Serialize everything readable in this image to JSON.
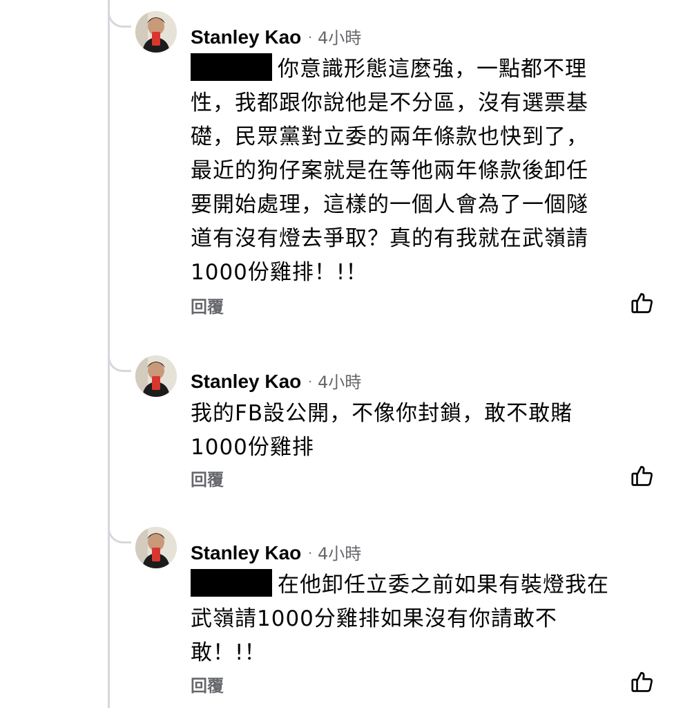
{
  "comments": [
    {
      "author": "Stanley Kao",
      "separator": "·",
      "time": "4小時",
      "lines": [
        "你意識形態這麼強，一點都不理",
        "性，我都跟你說他是不分區，沒有選票基",
        "礎，民眾黨對立委的兩年條款也快到了，",
        "最近的狗仔案就是在等他兩年條款後卸任",
        "要開始處理，這樣的一個人會為了一個隧",
        "道有沒有燈去爭取？真的有我就在武嶺請",
        "1000份雞排！!！"
      ],
      "reply_label": "回覆",
      "like_icon": "thumbs-up-icon"
    },
    {
      "author": "Stanley Kao",
      "separator": "·",
      "time": "4小時",
      "lines": [
        "我的FB設公開，不像你封鎖，敢不敢賭",
        "1000份雞排"
      ],
      "reply_label": "回覆",
      "like_icon": "thumbs-up-icon"
    },
    {
      "author": "Stanley Kao",
      "separator": "·",
      "time": "4小時",
      "lines": [
        "在他卸任立委之前如果有裝燈我在",
        "武嶺請1000分雞排如果沒有你請敢不",
        "敢！!！"
      ],
      "reply_label": "回覆",
      "like_icon": "thumbs-up-icon"
    }
  ],
  "colors": {
    "text": "#050505",
    "secondary": "#65676b",
    "thread_line": "#d6d8dc",
    "redaction": "#000000"
  }
}
